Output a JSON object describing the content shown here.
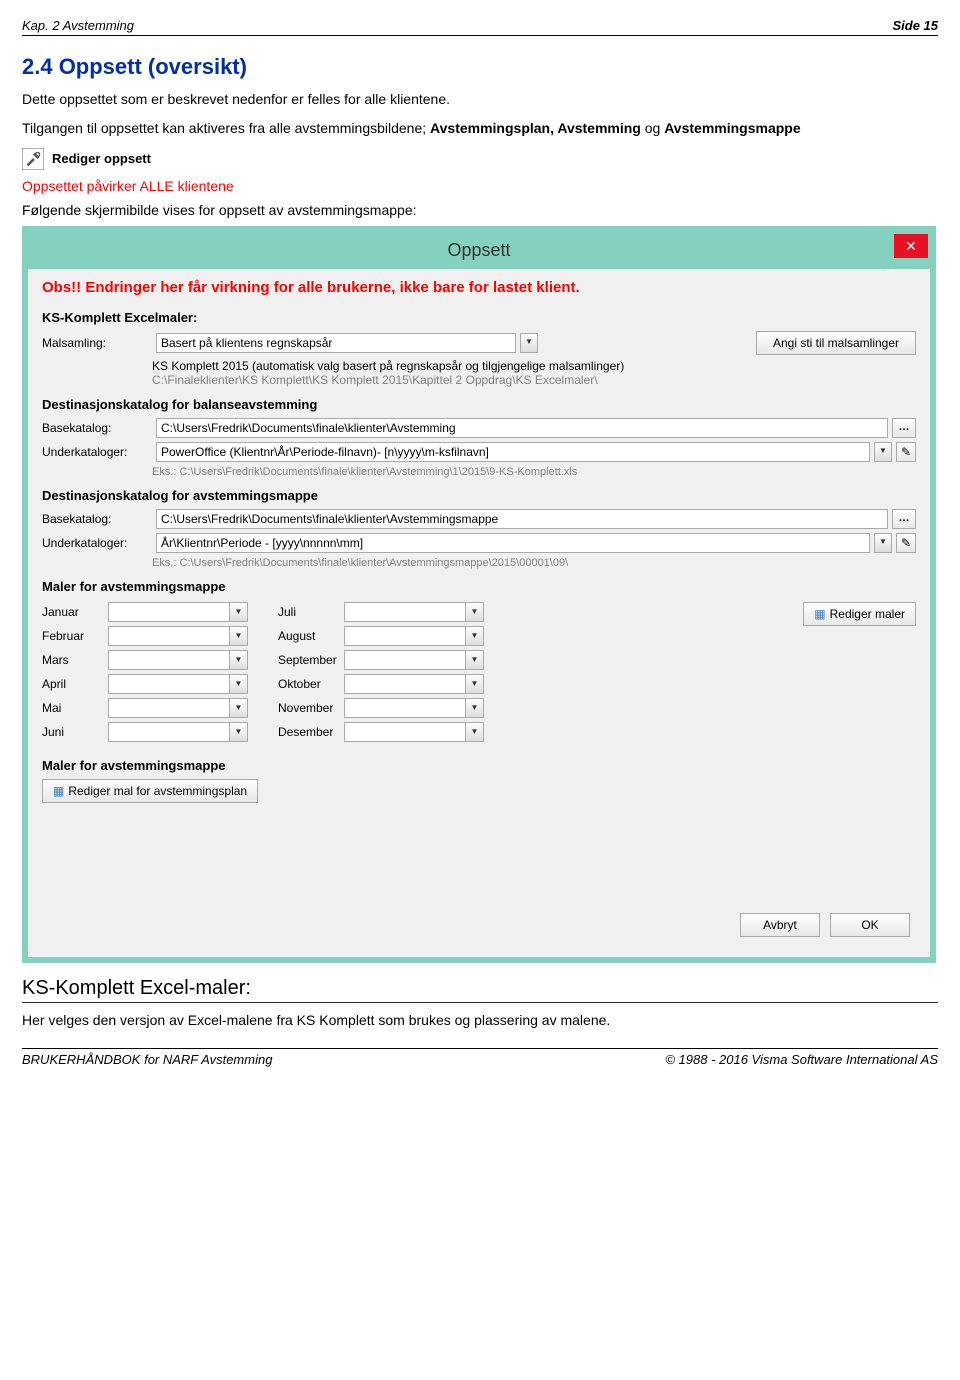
{
  "header": {
    "left": "Kap. 2 Avstemming",
    "right": "Side 15"
  },
  "section": {
    "title": "2.4  Oppsett (oversikt)",
    "p1": "Dette oppsettet som er beskrevet nedenfor er felles for alle klientene.",
    "p2a": "Tilgangen til oppsettet kan aktiveres fra alle avstemmingsbildene; ",
    "p2b": "Avstemmingsplan, Avstemming",
    "p2c": " og ",
    "p2d": "Avstemmingsmappe",
    "toolsLabel": "Rediger oppsett",
    "redLine": "Oppsettet påvirker ALLE klientene",
    "p3": "Følgende skjermibilde vises for oppsett av avstemmingsmappe:"
  },
  "dialog": {
    "title": "Oppsett",
    "obs": "Obs!! Endringer her får virkning for alle brukerne, ikke bare for lastet klient.",
    "ks": {
      "h": "KS-Komplett Excelmaler:",
      "malsamlingLbl": "Malsamling:",
      "malsamlingVal": "Basert på klientens regnskapsår",
      "angiSti": "Angi sti til malsamlinger",
      "line2": "KS Komplett 2015 (automatisk valg basert på regnskapsår og tilgjengelige malsamlinger)",
      "line3": "C:\\Finaleklienter\\KS Komplett\\KS Komplett 2015\\Kapittel 2 Oppdrag\\KS Excelmaler\\"
    },
    "bal": {
      "h": "Destinasjonskatalog for balanseavstemming",
      "baseLbl": "Basekatalog:",
      "baseVal": "C:\\Users\\Fredrik\\Documents\\finale\\klienter\\Avstemming",
      "underLbl": "Underkataloger:",
      "underVal": "PowerOffice (Klientnr\\År\\Periode-filnavn)- [n\\yyyy\\m-ksfilnavn]",
      "eks": "Eks.:    C:\\Users\\Fredrik\\Documents\\finale\\klienter\\Avstemming\\1\\2015\\9-KS-Komplett.xls"
    },
    "avm": {
      "h": "Destinasjonskatalog for avstemmingsmappe",
      "baseLbl": "Basekatalog:",
      "baseVal": "C:\\Users\\Fredrik\\Documents\\finale\\klienter\\Avstemmingsmappe",
      "underLbl": "Underkataloger:",
      "underVal": "År\\Klientnr\\Periode - [yyyy\\nnnnn\\mm]",
      "eks": "Eks.:    C:\\Users\\Fredrik\\Documents\\finale\\klienter\\Avstemmingsmappe\\2015\\00001\\09\\"
    },
    "maler": {
      "h": "Maler for avstemmingsmappe",
      "monthsL": [
        "Januar",
        "Februar",
        "Mars",
        "April",
        "Mai",
        "Juni"
      ],
      "monthsR": [
        "Juli",
        "August",
        "September",
        "Oktober",
        "November",
        "Desember"
      ],
      "redigerMaler": "Rediger maler"
    },
    "maler2": {
      "h": "Maler for avstemmingsmappe",
      "btn": "Rediger mal for avstemmingsplan"
    },
    "bottom": {
      "avbryt": "Avbryt",
      "ok": "OK"
    }
  },
  "ksSection": {
    "h": "KS-Komplett Excel-maler:",
    "p": "Her velges den versjon av Excel-malene fra KS Komplett som brukes og plassering av malene."
  },
  "footer": {
    "left": "BRUKERHÅNDBOK for NARF Avstemming",
    "right": "© 1988 - 2016 Visma Software International AS"
  }
}
